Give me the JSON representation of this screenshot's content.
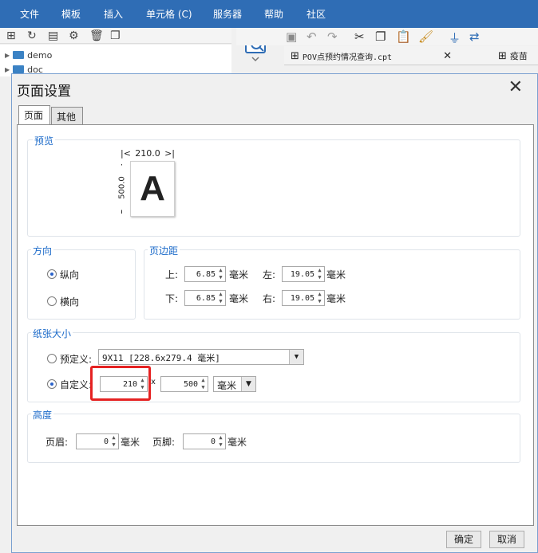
{
  "menubar": {
    "items": [
      "文件",
      "模板",
      "插入",
      "单元格 (C)",
      "服务器",
      "帮助",
      "社区"
    ]
  },
  "tree": {
    "items": [
      "demo",
      "doc"
    ]
  },
  "file_tabs": [
    {
      "label": "POV点预约情况查询.cpt"
    },
    {
      "label": "疫苗"
    }
  ],
  "dialog": {
    "title": "页面设置",
    "tabs": [
      "页面",
      "其他"
    ],
    "preview": {
      "title": "预览",
      "width_label": "210.0",
      "height_label": "500.0",
      "letter": "A"
    },
    "orientation": {
      "title": "方向",
      "portrait": "纵向",
      "landscape": "横向",
      "selected": "portrait"
    },
    "margins": {
      "title": "页边距",
      "top_label": "上:",
      "top_value": "6.85",
      "left_label": "左:",
      "left_value": "19.05",
      "bottom_label": "下:",
      "bottom_value": "6.85",
      "right_label": "右:",
      "right_value": "19.05",
      "unit": "毫米"
    },
    "paper": {
      "title": "纸张大小",
      "predefined_label": "预定义:",
      "predefined_value": "9X11 [228.6x279.4 毫米]",
      "custom_label": "自定义:",
      "custom_width": "210",
      "times": "x",
      "custom_height": "500",
      "unit_value": "毫米",
      "selected": "custom"
    },
    "height": {
      "title": "高度",
      "header_label": "页眉:",
      "header_value": "0",
      "footer_label": "页脚:",
      "footer_value": "0",
      "unit": "毫米"
    },
    "ok_label": "确定",
    "cancel_label": "取消"
  },
  "colors": {
    "menubar": "#2f6db5",
    "accent": "#1b6ac9",
    "highlight": "#e52222"
  }
}
